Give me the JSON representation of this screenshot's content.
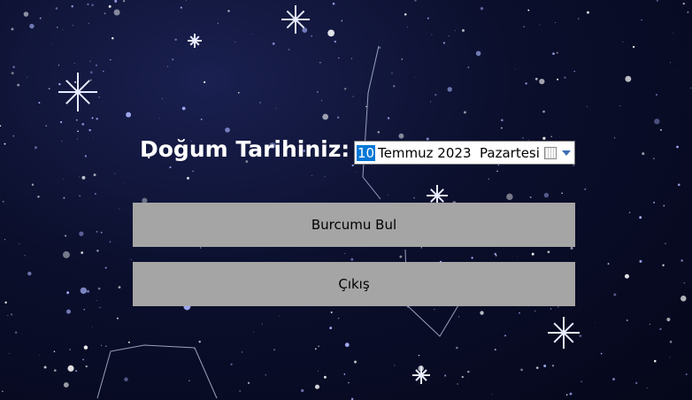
{
  "form": {
    "birth_date_label": "Doğum Tarihiniz:",
    "date_picker": {
      "day": "10",
      "rest": "Temmuz 2023  Pazartesi"
    },
    "find_sign_button": "Burcumu Bul",
    "exit_button": "Çıkış"
  }
}
